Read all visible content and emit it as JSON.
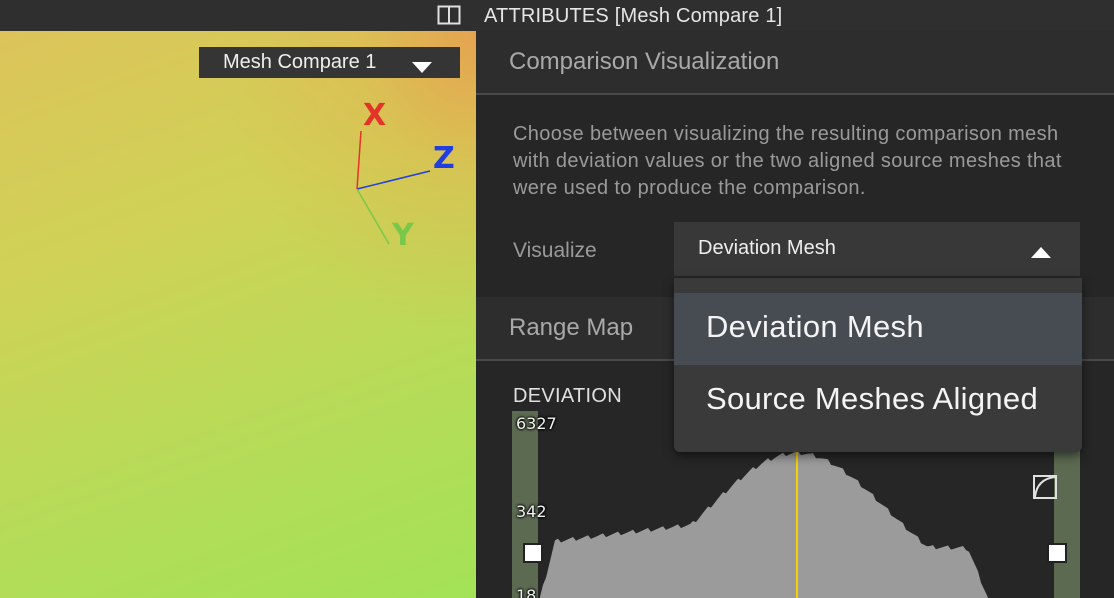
{
  "topbar": {
    "panel_toggle_icon": "split-panel-icon",
    "title": "ATTRIBUTES [Mesh Compare 1]"
  },
  "viewport": {
    "mesh_select": {
      "value": "Mesh Compare 1",
      "caret_icon": "caret-down-icon"
    },
    "axes": {
      "x": "X",
      "y": "Y",
      "z": "Z",
      "colors": {
        "x": "#e4342a",
        "y": "#7ac84a",
        "z": "#1f3fe0"
      }
    }
  },
  "comparison": {
    "header": "Comparison Visualization",
    "description": "Choose between visualizing the resulting comparison mesh with deviation values or the two aligned source meshes that were used to produce the comparison.",
    "visualize_label": "Visualize",
    "visualize_value": "Deviation Mesh",
    "caret_icon": "caret-up-icon"
  },
  "range_map": {
    "header": "Range Map",
    "deviation_label": "DEVIATION",
    "ticks": [
      "6327",
      "342",
      "18"
    ],
    "marker_color": "#f2d300"
  },
  "dropdown": {
    "options": [
      "Deviation Mesh",
      "Source Meshes Aligned"
    ],
    "selected": "Deviation Mesh"
  },
  "colors": {
    "panel_bg": "#262626",
    "header_bg": "#2d2d2d",
    "histogram": "#9b9b9b",
    "accent_track": "#5c6a52"
  }
}
